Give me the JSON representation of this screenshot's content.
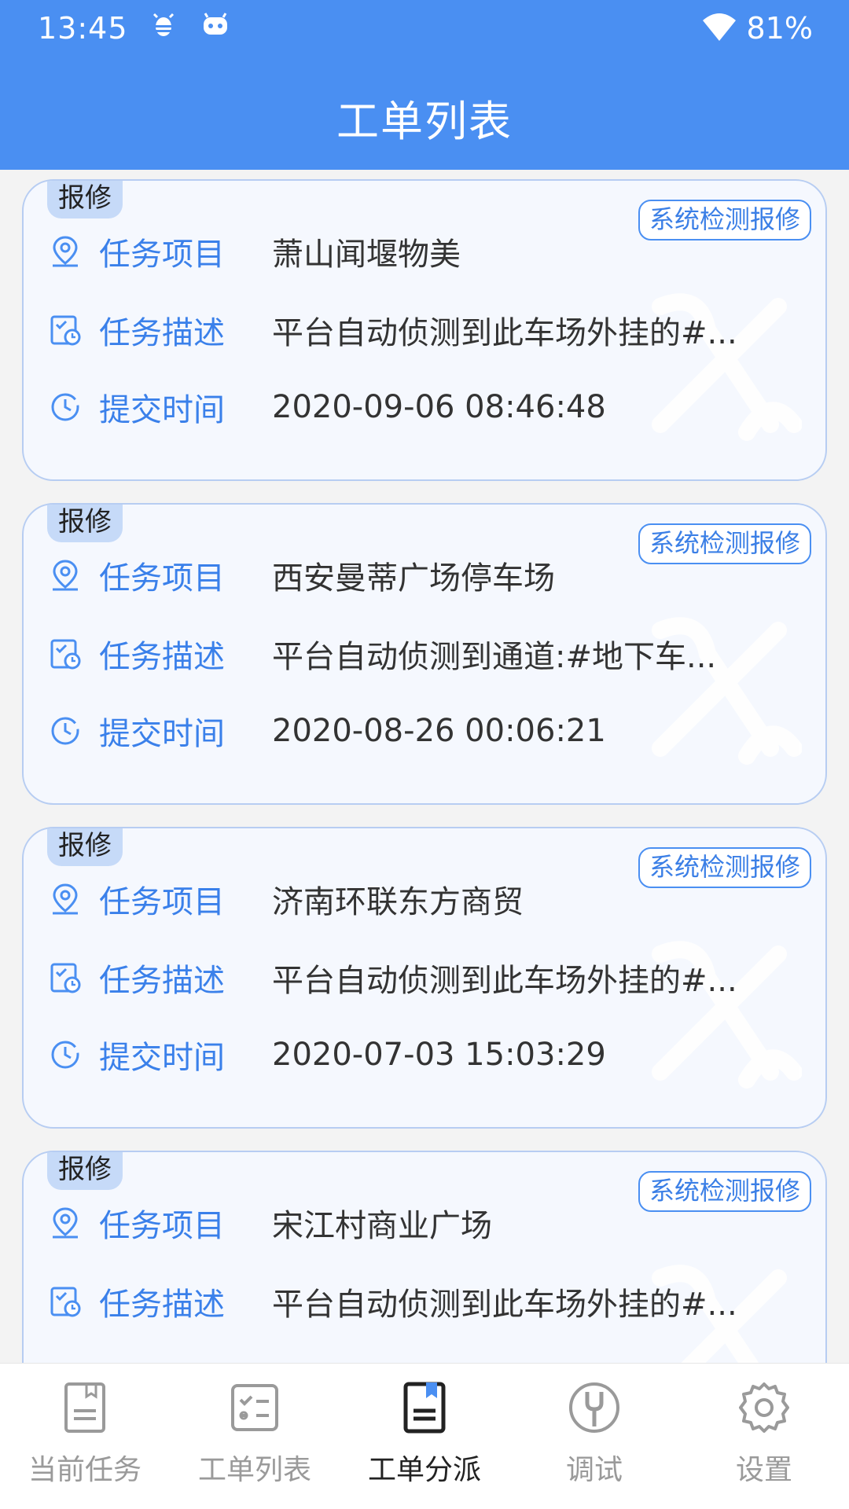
{
  "status_bar": {
    "time": "13:45",
    "battery": "81%"
  },
  "app_bar": {
    "title": "工单列表"
  },
  "orders": [
    {
      "type": "报修",
      "source": "系统检测报修",
      "project_label": "任务项目",
      "project": "萧山闻堰物美",
      "desc_label": "任务描述",
      "desc": "平台自动侦测到此车场外挂的#...",
      "time_label": "提交时间",
      "time": "2020-09-06 08:46:48"
    },
    {
      "type": "报修",
      "source": "系统检测报修",
      "project_label": "任务项目",
      "project": "西安曼蒂广场停车场",
      "desc_label": "任务描述",
      "desc": "平台自动侦测到通道:#地下车...",
      "time_label": "提交时间",
      "time": "2020-08-26 00:06:21"
    },
    {
      "type": "报修",
      "source": "系统检测报修",
      "project_label": "任务项目",
      "project": "济南环联东方商贸",
      "desc_label": "任务描述",
      "desc": "平台自动侦测到此车场外挂的#...",
      "time_label": "提交时间",
      "time": "2020-07-03 15:03:29"
    },
    {
      "type": "报修",
      "source": "系统检测报修",
      "project_label": "任务项目",
      "project": "宋江村商业广场",
      "desc_label": "任务描述",
      "desc": "平台自动侦测到此车场外挂的#...",
      "time_label": "提交时间",
      "time": ""
    }
  ],
  "tabs": [
    {
      "label": "当前任务",
      "icon": "document-icon",
      "active": false
    },
    {
      "label": "工单列表",
      "icon": "checklist-icon",
      "active": false
    },
    {
      "label": "工单分派",
      "icon": "bookmark-doc-icon",
      "active": true
    },
    {
      "label": "调试",
      "icon": "wrench-icon",
      "active": false
    },
    {
      "label": "设置",
      "icon": "gear-icon",
      "active": false
    }
  ],
  "colors": {
    "primary": "#4a8ff2",
    "accent_text": "#3a80ea",
    "card_bg": "#f5f8fe",
    "card_border": "#b7cdf2",
    "tag_bg": "#c6daf8"
  }
}
